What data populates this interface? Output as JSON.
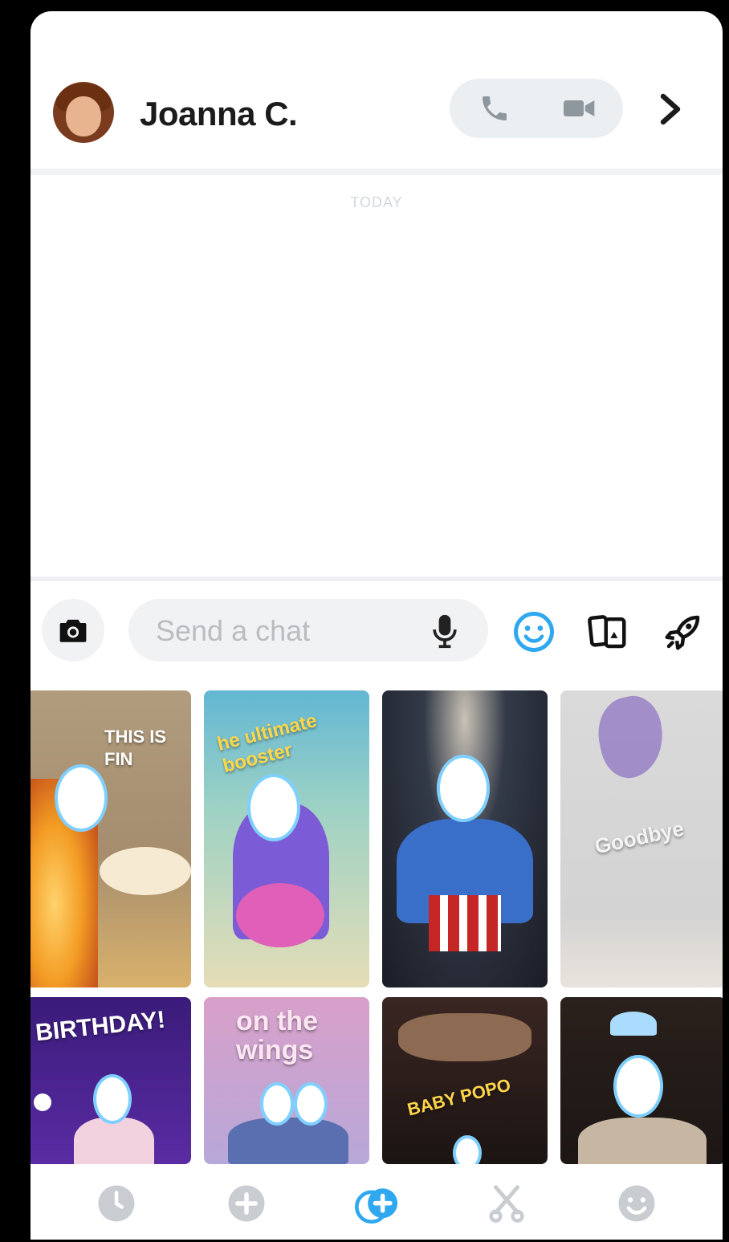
{
  "contact": {
    "name": "Joanna C."
  },
  "header": {
    "call_icon": "phone-icon",
    "video_icon": "video-camera-icon",
    "more_icon": "chevron-right-icon"
  },
  "conversation": {
    "date_label": "TODAY"
  },
  "composer": {
    "placeholder": "Send a chat",
    "camera_icon": "camera-icon",
    "mic_icon": "microphone-icon",
    "emoji_icon": "smiley-icon",
    "cards_icon": "cards-icon",
    "games_icon": "rocket-icon",
    "accent_color": "#2fa8ef"
  },
  "stickers": [
    {
      "caption": "THIS IS FIN"
    },
    {
      "caption": "he ultimate booster"
    },
    {
      "caption": ""
    },
    {
      "caption": "Goodbye"
    },
    {
      "caption": "BIRTHDAY!"
    },
    {
      "caption": "on the wings"
    },
    {
      "caption": "BABY POPO"
    },
    {
      "caption": ""
    }
  ],
  "bottom_nav": [
    {
      "icon": "clock-icon",
      "active": false
    },
    {
      "icon": "plus-circle-icon",
      "active": false
    },
    {
      "icon": "cameos-icon",
      "active": true
    },
    {
      "icon": "scissors-icon",
      "active": false
    },
    {
      "icon": "bitmoji-smiley-icon",
      "active": false
    }
  ]
}
